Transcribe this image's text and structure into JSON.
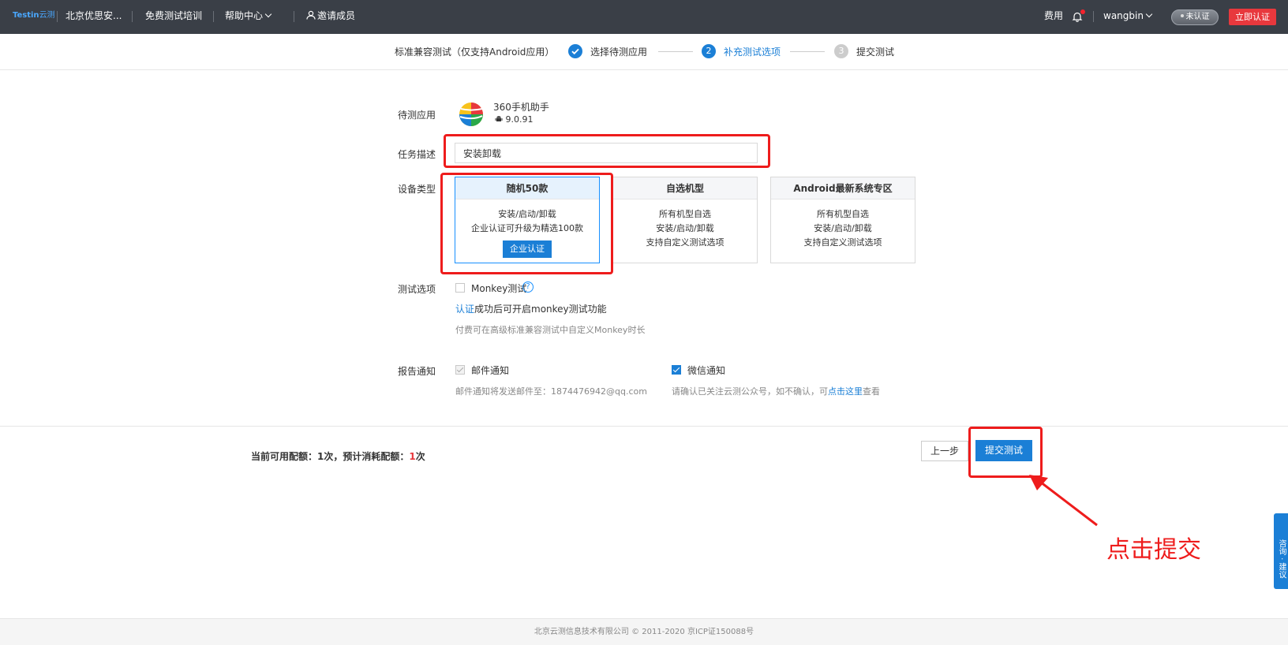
{
  "nav": {
    "logo": "Testin",
    "logo_suffix": "云测",
    "org": "北京优思安...",
    "training": "免费测试培训",
    "help": "帮助中心",
    "invite": "邀请成员",
    "fee": "费用",
    "username": "wangbin",
    "unverified": "未认证",
    "verify_now": "立即认证"
  },
  "steps": {
    "title": "标准兼容测试（仅支持Android应用）",
    "step1": "选择待测应用",
    "step2_num": "2",
    "step2": "补充测试选项",
    "step3_num": "3",
    "step3": "提交测试"
  },
  "form": {
    "app_label": "待测应用",
    "app_name": "360手机助手",
    "app_version": "9.0.91",
    "task_label": "任务描述",
    "task_value": "安装卸载",
    "device_label": "设备类型",
    "cards": [
      {
        "title": "随机50款",
        "lines": [
          "安装/启动/卸载",
          "企业认证可升级为精选100款"
        ],
        "button": "企业认证"
      },
      {
        "title": "自选机型",
        "lines": [
          "所有机型自选",
          "安装/启动/卸载",
          "支持自定义测试选项"
        ]
      },
      {
        "title": "Android最新系统专区",
        "lines": [
          "所有机型自选",
          "安装/启动/卸载",
          "支持自定义测试选项"
        ]
      }
    ],
    "test_options_label": "测试选项",
    "monkey": "Monkey测试",
    "help_mark": "?",
    "auth_link": "认证",
    "auth_tail": "成功后可开启monkey测试功能",
    "monkey_note": "付费可在高级标准兼容测试中自定义Monkey时长",
    "report_label": "报告通知",
    "email_notify": "邮件通知",
    "email_note": "邮件通知将发送邮件至：1874476942@qq.com",
    "wechat_notify": "微信通知",
    "wechat_note_pre": "请确认已关注云测公众号，如不确认，可",
    "wechat_link": "点击这里",
    "wechat_note_post": "查看"
  },
  "bottom": {
    "quota_pre": "当前可用配额：",
    "quota_avail": "1次，预计消耗配额：",
    "quota_cost": "1",
    "quota_unit": "次",
    "prev": "上一步",
    "submit": "提交测试"
  },
  "annotation": "点击提交",
  "footer": "北京云测信息技术有限公司 © 2011-2020 京ICP证150088号",
  "side_tab": "咨询 · 建议",
  "colors": {
    "accent": "#1b7fd6",
    "nav_bg": "#3a3f47",
    "annotation": "#ee1c1c"
  }
}
